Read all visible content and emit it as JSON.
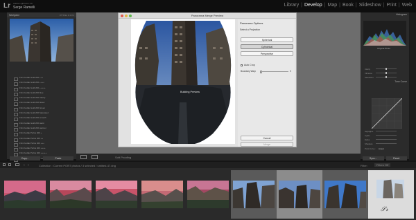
{
  "app": {
    "logo": "Lr",
    "identity_small": "Adobe Lightroom CC",
    "identity_name": "Serge Ramelli"
  },
  "modules": [
    "Library",
    "Develop",
    "Map",
    "Book",
    "Slideshow",
    "Print",
    "Web"
  ],
  "active_module": "Develop",
  "left_panel": {
    "navigator_title": "Navigator",
    "navigator_zoom": "FIT  FILL  1:1  3:1",
    "presets": [
      "Film Kodak Gold 200 +++",
      "Film Kodak Gold 200 ++++",
      "Film Kodak Gold 200 +++++",
      "Film Kodak Gold 200 blue",
      "Film Kodak Gold 200 Clarity",
      "Film Kodak Gold 200 faded",
      "Film Kodak Gold 200 Green",
      "Film Kodak Gold 200 Saturated",
      "Film Kodak Gold 200 smooth",
      "Film Kodak Gold 200 warm",
      "Film Kodak Gold 200 warmer",
      "Film Kodak Portra 400 +",
      "Film Kodak Portra 400 ++",
      "Film Kodak Portra 400 +++",
      "Film Kodak Portra 400 ++++",
      "Film Kodak Portra 400 +++++",
      "Film Kodak Portra 400 ++++++",
      "Film Kodak Tri-X 400",
      "Film Kodak Tri-X 400 +",
      "Film Kodak Tri-X 400 ++"
    ],
    "copy_label": "Copy...",
    "paste_label": "Paste"
  },
  "toolbar": {
    "soft_proofing": "Soft Proofing"
  },
  "dialog": {
    "title": "Panorama Merge Preview",
    "preview_label": "Building Preview",
    "options_title": "Panorama Options",
    "select_projection": "Select a Projection",
    "projections": [
      "Spherical",
      "Cylindrical",
      "Perspective"
    ],
    "selected_projection": "Cylindrical",
    "auto_crop": "Auto Crop",
    "boundary_warp_label": "Boundary Warp",
    "boundary_warp_value": "0",
    "boundary_warp_fraction": 0,
    "cancel_label": "Cancel",
    "merge_label": "Merge"
  },
  "right_panel": {
    "histogram_title": "Histogram",
    "original_photo": "Original Photo",
    "tone_curve_title": "Tone Curve",
    "presence_rows": [
      "Clarity",
      "Vibrance",
      "Saturation"
    ],
    "curve_rows": [
      "Highlights",
      "Lights",
      "Darks",
      "Shadows"
    ],
    "point_curve_label": "Point Curve :",
    "point_curve_value": "Linear",
    "sync_label": "Sync...",
    "reset_label": "Reset"
  },
  "filmstrip": {
    "source_text": "Collection : Current POP",
    "count_text": "17 photos / 3 selected / untitled-47.dng",
    "filter_label": "Filter :",
    "filter_value": "Filters Off"
  },
  "colors": {
    "accent": "#f0f0f0",
    "panel_bg": "#2b2b2b",
    "center_bg": "#6d6d6d"
  }
}
